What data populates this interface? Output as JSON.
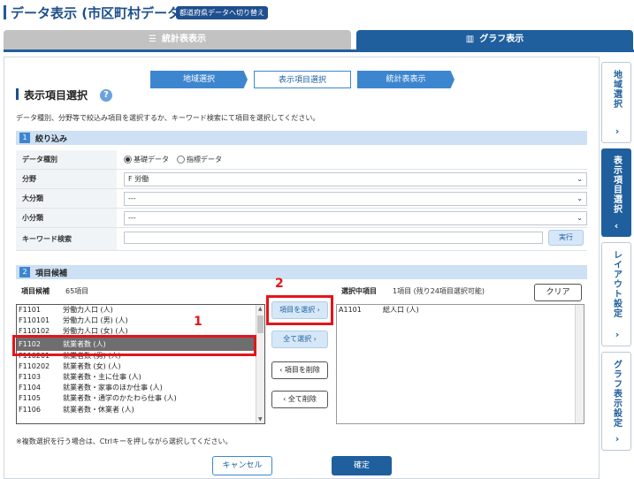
{
  "header": {
    "title": "データ表示 (市区町村データ)",
    "switch_button": "都道府県データへ切り替え"
  },
  "tabs": {
    "stat": "統計表表示",
    "graph": "グラフ表示"
  },
  "steps": [
    "地域選択",
    "表示項目選択",
    "統計表表示"
  ],
  "section": {
    "title": "表示項目選択",
    "help": "?",
    "description": "データ種別、分野等で絞込み項目を選択するか、キーワード検索にて項目を選択してください。"
  },
  "filter": {
    "number": "1",
    "label": "絞り込み",
    "rows": {
      "data_type_label": "データ種別",
      "data_type_options": [
        "基礎データ",
        "指標データ"
      ],
      "field_label": "分野",
      "field_value": "F 労働",
      "major_label": "大分類",
      "major_value": "---",
      "minor_label": "小分類",
      "minor_value": "---",
      "keyword_label": "キーワード検索",
      "keyword_value": "",
      "exec_button": "実行"
    }
  },
  "candidates": {
    "number": "2",
    "label": "項目候補",
    "list_label": "項目候補",
    "count": "65項目",
    "items": [
      {
        "code": "F1101",
        "name": "労働力人口 (人)"
      },
      {
        "code": "F110101",
        "name": "労働力人口 (男) (人)"
      },
      {
        "code": "F110102",
        "name": "労働力人口 (女) (人)"
      },
      {
        "code": "F1102",
        "name": "就業者数 (人)"
      },
      {
        "code": "F110201",
        "name": "就業者数 (男) (人)"
      },
      {
        "code": "F110202",
        "name": "就業者数 (女) (人)"
      },
      {
        "code": "F1103",
        "name": "就業者数・主に仕事 (人)"
      },
      {
        "code": "F1104",
        "name": "就業者数・家事のほか仕事 (人)"
      },
      {
        "code": "F1105",
        "name": "就業者数・通学のかたわら仕事 (人)"
      },
      {
        "code": "F1106",
        "name": "就業者数・休業者 (人)"
      }
    ]
  },
  "annotations": {
    "marker1": "1",
    "marker2": "2"
  },
  "actions": {
    "select_item": "項目を選択",
    "select_all": "全て選択",
    "remove_item": "項目を削除",
    "remove_all": "全て削除"
  },
  "selected": {
    "label": "選択中項目",
    "info": "1項目 (残り24項目選択可能)",
    "clear_button": "クリア",
    "items": [
      {
        "code": "A1101",
        "name": "総人口 (人)"
      }
    ]
  },
  "note": "※複数選択を行う場合は、Ctrlキーを押しながら選択してください。",
  "footer": {
    "cancel": "キャンセル",
    "ok": "確定"
  },
  "side_tabs": [
    {
      "label": "地域選択"
    },
    {
      "label": "表示項目選択"
    },
    {
      "label": "レイアウト設定"
    },
    {
      "label": "グラフ表示設定"
    }
  ],
  "colors": {
    "primary": "#1f5f9e",
    "step_blue": "#3d86cf",
    "section_head": "#cde0f4",
    "highlight": "#e3151b",
    "selected_row": "#6e6e6e"
  }
}
